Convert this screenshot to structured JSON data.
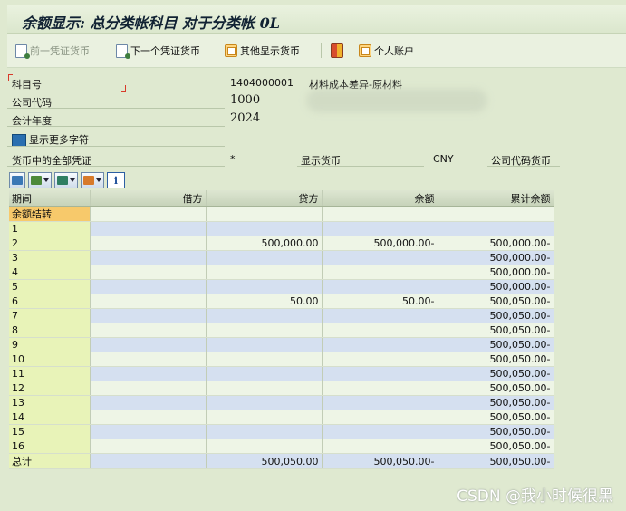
{
  "window": {
    "title": "余额显示: 总分类帐科目 对于分类帐 0L"
  },
  "toolbar": {
    "prev_label": "前一凭证货币",
    "next_label": "下一个凭证货币",
    "other_label": "其他显示货币",
    "personal_label": "个人账户"
  },
  "header": {
    "account_label": "科目号",
    "account_value": "1404000001",
    "account_desc": "材料成本差异-原材料",
    "company_label": "公司代码",
    "company_value": "1000",
    "year_label": "会计年度",
    "year_value": "2024",
    "more_chars_label": "显示更多字符",
    "all_docs_label": "货币中的全部凭证",
    "all_docs_value": "*",
    "display_currency_label": "显示货币",
    "display_currency_value": "CNY",
    "company_currency_label": "公司代码货币"
  },
  "table": {
    "columns": [
      "期间",
      "借方",
      "贷方",
      "余额",
      "累计余额"
    ],
    "rows": [
      {
        "period": "余额结转",
        "debit": "",
        "credit": "",
        "balance": "",
        "cumulative": ""
      },
      {
        "period": "1",
        "debit": "",
        "credit": "",
        "balance": "",
        "cumulative": ""
      },
      {
        "period": "2",
        "debit": "",
        "credit": "500,000.00",
        "balance": "500,000.00-",
        "cumulative": "500,000.00-"
      },
      {
        "period": "3",
        "debit": "",
        "credit": "",
        "balance": "",
        "cumulative": "500,000.00-"
      },
      {
        "period": "4",
        "debit": "",
        "credit": "",
        "balance": "",
        "cumulative": "500,000.00-"
      },
      {
        "period": "5",
        "debit": "",
        "credit": "",
        "balance": "",
        "cumulative": "500,000.00-"
      },
      {
        "period": "6",
        "debit": "",
        "credit": "50.00",
        "balance": "50.00-",
        "cumulative": "500,050.00-"
      },
      {
        "period": "7",
        "debit": "",
        "credit": "",
        "balance": "",
        "cumulative": "500,050.00-"
      },
      {
        "period": "8",
        "debit": "",
        "credit": "",
        "balance": "",
        "cumulative": "500,050.00-"
      },
      {
        "period": "9",
        "debit": "",
        "credit": "",
        "balance": "",
        "cumulative": "500,050.00-"
      },
      {
        "period": "10",
        "debit": "",
        "credit": "",
        "balance": "",
        "cumulative": "500,050.00-"
      },
      {
        "period": "11",
        "debit": "",
        "credit": "",
        "balance": "",
        "cumulative": "500,050.00-"
      },
      {
        "period": "12",
        "debit": "",
        "credit": "",
        "balance": "",
        "cumulative": "500,050.00-"
      },
      {
        "period": "13",
        "debit": "",
        "credit": "",
        "balance": "",
        "cumulative": "500,050.00-"
      },
      {
        "period": "14",
        "debit": "",
        "credit": "",
        "balance": "",
        "cumulative": "500,050.00-"
      },
      {
        "period": "15",
        "debit": "",
        "credit": "",
        "balance": "",
        "cumulative": "500,050.00-"
      },
      {
        "period": "16",
        "debit": "",
        "credit": "",
        "balance": "",
        "cumulative": "500,050.00-"
      },
      {
        "period": "总计",
        "debit": "",
        "credit": "500,050.00",
        "balance": "500,050.00-",
        "cumulative": "500,050.00-"
      }
    ]
  },
  "watermark": "CSDN @我小时候很黑",
  "colors": {
    "background": "#dfe9d0",
    "period_cell": "#e8f3b8",
    "carry_forward_cell": "#f7c96b",
    "alt_row": "#d5e0f0"
  }
}
